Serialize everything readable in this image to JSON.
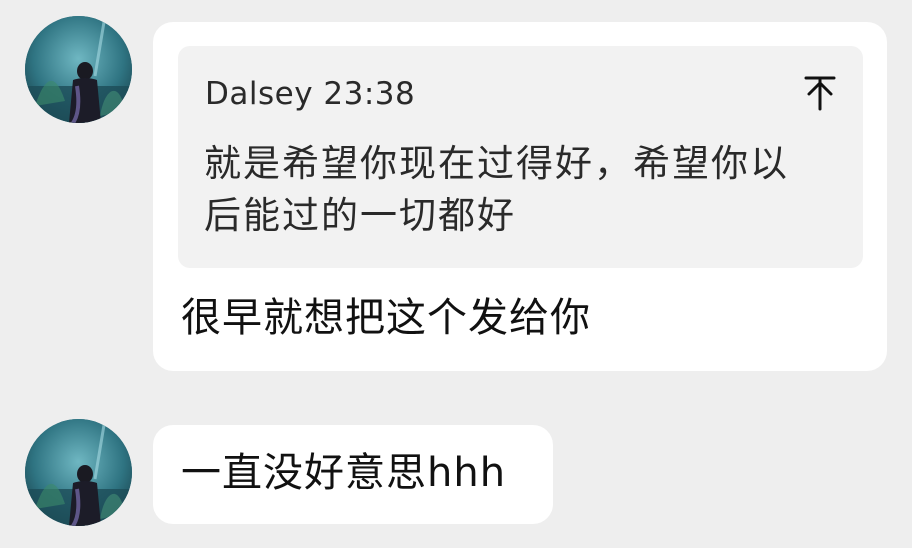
{
  "messages": [
    {
      "quote": {
        "author": "Dalsey",
        "time": "23:38",
        "header": "Dalsey 23:38",
        "text": "就是希望你现在过得好，希望你以后能过的一切都好",
        "pin_icon": "pin-to-top-icon"
      },
      "text": "很早就想把这个发给你"
    },
    {
      "text": "一直没好意思hhh"
    }
  ],
  "colors": {
    "background": "#eeeeee",
    "bubble": "#ffffff",
    "quote_background": "#f2f2f2"
  }
}
